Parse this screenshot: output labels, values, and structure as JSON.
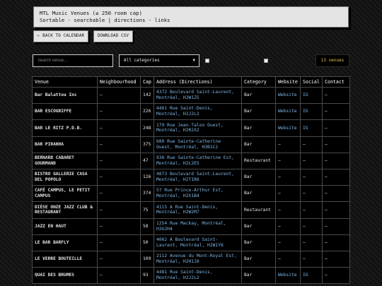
{
  "header": {
    "title": "MTL Music Venues (≤ 250 room cap)",
    "subtitle": "Sortable · searchable | directions · links"
  },
  "buttons": {
    "back": "← BACK TO CALENDAR",
    "download": "DOWNLOAD CSV"
  },
  "filters": {
    "search_placeholder": "Search venue…",
    "category_selected": "All categories",
    "count": "13 venues"
  },
  "table": {
    "columns": [
      "Venue",
      "Neighbourhood",
      "Cap",
      "Address (Directions)",
      "Category",
      "Website",
      "Social",
      "Contact"
    ],
    "rows": [
      {
        "venue": "Bar Balattou Inc",
        "mixed": true,
        "neigh": "—",
        "cap": "142",
        "addr": "4372 Boulevard Saint-Laurent, Montréal, H2W1Z5",
        "cat": "Bar",
        "web": "Website",
        "social": "IG",
        "contact": "—"
      },
      {
        "venue": "BAR ESCOGRIFFE",
        "neigh": "—",
        "cap": "226",
        "addr": "4461 Rue Saint-Denis, Montréal, H2J2L2",
        "cat": "Bar",
        "web": "Website",
        "social": "IG",
        "contact": "—"
      },
      {
        "venue": "BAR LE RITZ P.D.B.",
        "neigh": "—",
        "cap": "248",
        "addr": "179 Rue Jean-Talon Ouest, Montréal, H2R2X2",
        "cat": "Bar",
        "web": "Website",
        "social": "IG",
        "contact": "—"
      },
      {
        "venue": "BAR PIRANHA",
        "neigh": "—",
        "cap": "375",
        "addr": "680 Rue Sainte-Catherine Ouest, Montréal, H3B1C2",
        "cat": "Bar",
        "web": "—",
        "social": "—",
        "contact": "—"
      },
      {
        "venue": "BERNARD CABARET GOURMAND",
        "neigh": "—",
        "cap": "47",
        "addr": "936 Rue Sainte-Catherine Est, Montréal, H2L2E5",
        "cat": "Restaurant",
        "web": "—",
        "social": "—",
        "contact": "—"
      },
      {
        "venue": "BISTRO GALLERIE CASA DEL POPOLO",
        "neigh": "—",
        "cap": "126",
        "addr": "4873 Boulevard Saint-Laurent, Montréal, H2T1R6",
        "cat": "Bar",
        "web": "—",
        "social": "—",
        "contact": "—"
      },
      {
        "venue": "CAFÉ CAMPUS, LE PETIT CAMPUS",
        "neigh": "—",
        "cap": "374",
        "addr": "57 Rue Prince-Arthur Est, Montréal, H2X1B4",
        "cat": "Bar",
        "web": "—",
        "social": "—",
        "contact": "—"
      },
      {
        "venue": "DIÈSE ONZE JAZZ CLUB & RESTAURANT",
        "neigh": "—",
        "cap": "75",
        "addr": "4115 A Rue Saint-Denis, Montréal, H2W2M7",
        "cat": "Restaurant",
        "web": "—",
        "social": "—",
        "contact": "—"
      },
      {
        "venue": "JAZZ EN HAUT",
        "neigh": "—",
        "cap": "58",
        "addr": "1254 Rue Mackay, Montréal, H3G2H4",
        "cat": "Bar",
        "web": "—",
        "social": "—",
        "contact": "—"
      },
      {
        "venue": "LE BAR BARFLY",
        "neigh": "—",
        "cap": "50",
        "addr": "4062 A Boulevard Saint-Laurent, Montréal, H2W1Y8",
        "cat": "Bar",
        "web": "—",
        "social": "—",
        "contact": "—"
      },
      {
        "venue": "LE VERRE BOUTEILLE",
        "neigh": "—",
        "cap": "109",
        "addr": "2112 Avenue du Mont-Royal Est, Montréal, H2H1J8",
        "cat": "Bar",
        "web": "—",
        "social": "—",
        "contact": "—"
      },
      {
        "venue": "QUAI DES BRUMES",
        "neigh": "—",
        "cap": "93",
        "addr": "4481 Rue Saint-Denis, Montréal, H2J2L2",
        "cat": "Bar",
        "web": "Website",
        "social": "IG",
        "contact": "—"
      }
    ]
  },
  "colors": {
    "accent_link": "#7fb6e3",
    "count_text": "#e8c24a",
    "panel_bg": "#e4e4e4",
    "table_bg": "#000000"
  }
}
